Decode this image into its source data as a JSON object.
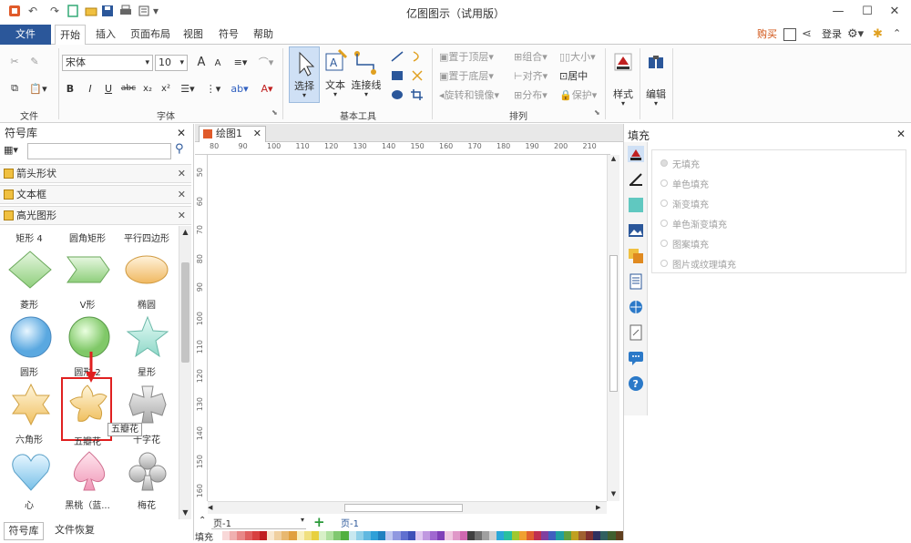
{
  "titlebar": {
    "title": "亿图图示（试用版）"
  },
  "menu": {
    "file": "文件",
    "home": "开始",
    "insert": "插入",
    "layout": "页面布局",
    "view": "视图",
    "symbol": "符号",
    "help": "帮助",
    "buy": "购买",
    "login": "登录"
  },
  "ribbon": {
    "font_name": "宋体",
    "font_size": "10",
    "groups": {
      "file": "文件",
      "font": "字体",
      "basic_tools": "基本工具",
      "arrange": "排列",
      "style": "样式",
      "edit": "编辑"
    },
    "tools": {
      "select": "选择",
      "text": "文本",
      "connector": "连接线"
    },
    "arrange": {
      "bring_front": "置于顶层",
      "send_back": "置于底层",
      "rotate_mirror": "旋转和镜像",
      "group": "组合",
      "align": "对齐",
      "distribute": "分布",
      "size": "大小",
      "center": "居中",
      "protect": "保护"
    },
    "format": {
      "bold": "B",
      "italic": "I",
      "underline": "U",
      "strike": "abc",
      "sub": "x₂",
      "sup": "x²",
      "font_grow": "A",
      "font_shrink": "A",
      "font_color": "A"
    }
  },
  "library": {
    "title": "符号库",
    "categories": [
      "箭头形状",
      "文本框",
      "高光图形"
    ],
    "top_labels": [
      "矩形 4",
      "圆角矩形",
      "平行四边形"
    ],
    "rows": [
      [
        "菱形",
        "V形",
        "椭圆"
      ],
      [
        "圆形",
        "圆形 2",
        "星形"
      ],
      [
        "六角形",
        "五瓣花",
        "十字花"
      ],
      [
        "心",
        "黑桃（蓝...",
        "梅花"
      ]
    ],
    "tooltip": "五瓣花",
    "bottom_tabs": [
      "符号库",
      "文件恢复"
    ]
  },
  "canvas": {
    "tab": "绘图1",
    "ruler_h": [
      "80",
      "90",
      "100",
      "110",
      "120",
      "130",
      "140",
      "150",
      "160",
      "170",
      "180",
      "190",
      "200",
      "210"
    ],
    "ruler_v": [
      "50",
      "60",
      "70",
      "80",
      "90",
      "100",
      "110",
      "120",
      "130",
      "140",
      "150",
      "160"
    ],
    "page_select": "页-1",
    "page_tab": "页-1",
    "fill_label": "填充"
  },
  "fill_panel": {
    "title": "填充",
    "options": [
      "无填充",
      "单色填充",
      "渐变填充",
      "单色渐变填充",
      "图案填充",
      "图片或纹理填充"
    ]
  },
  "colors": {
    "file_tab": "#2b579a",
    "accent_red": "#e02020",
    "shape_yellow": "#f5c96a"
  }
}
